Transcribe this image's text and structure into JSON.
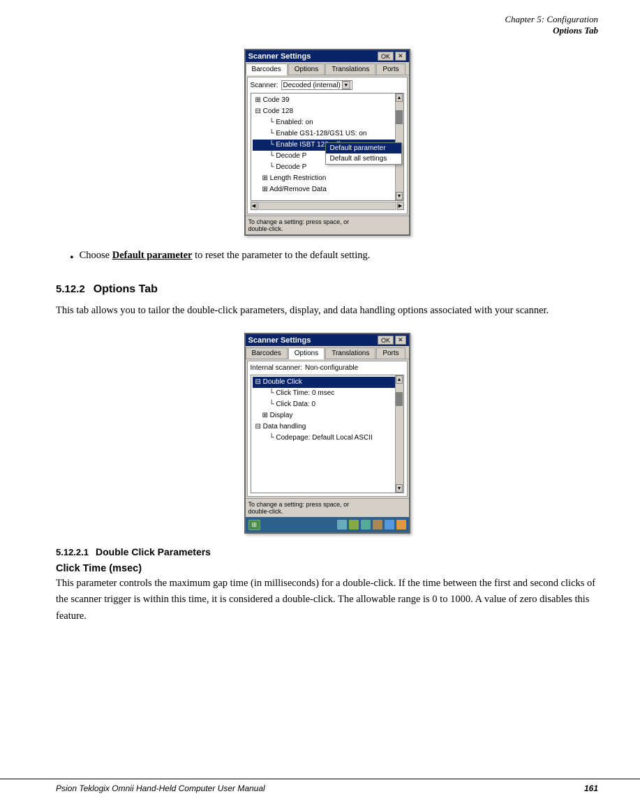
{
  "header": {
    "line1": "Chapter 5:  Configuration",
    "line2": "Options Tab"
  },
  "window1": {
    "title": "Scanner Settings",
    "btn_ok": "OK",
    "btn_close": "✕",
    "tabs": [
      "Barcodes",
      "Options",
      "Translations",
      "Ports"
    ],
    "active_tab": "Barcodes",
    "scanner_label": "Scanner:",
    "scanner_value": "Decoded (internal)",
    "tree_items": [
      {
        "text": "+ Code 39",
        "indent": 0
      },
      {
        "text": "- Code 128",
        "indent": 0
      },
      {
        "text": "Enabled: on",
        "indent": 2
      },
      {
        "text": "Enable GS1-128/GS1 US: on",
        "indent": 2
      },
      {
        "text": "Enable ISBT 128: off",
        "indent": 2,
        "highlight": true
      },
      {
        "text": "Decode P",
        "indent": 2
      },
      {
        "text": "Decode P",
        "indent": 2
      },
      {
        "text": "+ Length Restriction",
        "indent": 1
      },
      {
        "text": "+ Add/Remove Data",
        "indent": 1
      }
    ],
    "context_menu": [
      {
        "text": "Default parameter",
        "highlight": true
      },
      {
        "text": "Default all settings",
        "highlight": false
      }
    ],
    "footer": "To change a setting: press space, or\ndouble-click."
  },
  "bullet": {
    "text_before": "Choose ",
    "bold_text": "Default parameter",
    "text_after": " to reset the parameter to the default setting."
  },
  "section512": {
    "number": "5.12.2",
    "title": "Options Tab",
    "body": "This tab allows you to tailor the double-click parameters, display, and data handling options associated with your scanner."
  },
  "window2": {
    "title": "Scanner Settings",
    "btn_ok": "OK",
    "btn_close": "✕",
    "tabs": [
      "Barcodes",
      "Options",
      "Translations",
      "Ports"
    ],
    "active_tab": "Options",
    "scanner_label": "Internal scanner:",
    "scanner_value": "Non-configurable",
    "tree_items": [
      {
        "text": "- Double Click",
        "indent": 0,
        "highlight": true
      },
      {
        "text": "- Click Time: 0 msec",
        "indent": 2
      },
      {
        "text": "- Click Data: 0",
        "indent": 2
      },
      {
        "text": "+ Display",
        "indent": 1
      },
      {
        "text": "- Data handling",
        "indent": 0
      },
      {
        "text": "- Codepage: Default Local ASCII",
        "indent": 2
      }
    ],
    "footer": "To change a setting: press space, or\ndouble-click."
  },
  "section52121": {
    "number": "5.12.2.1",
    "title": "Double Click Parameters"
  },
  "click_time": {
    "heading": "Click Time (msec)",
    "body": "This parameter controls the maximum gap time (in milliseconds) for a double-click. If the time between the first and second clicks of the scanner trigger is within this time, it is considered a double-click. The allowable range is 0 to 1000. A value of zero disables this feature."
  },
  "footer": {
    "text": "Psion Teklogix Omnii Hand-Held Computer User Manual",
    "page": "161"
  }
}
